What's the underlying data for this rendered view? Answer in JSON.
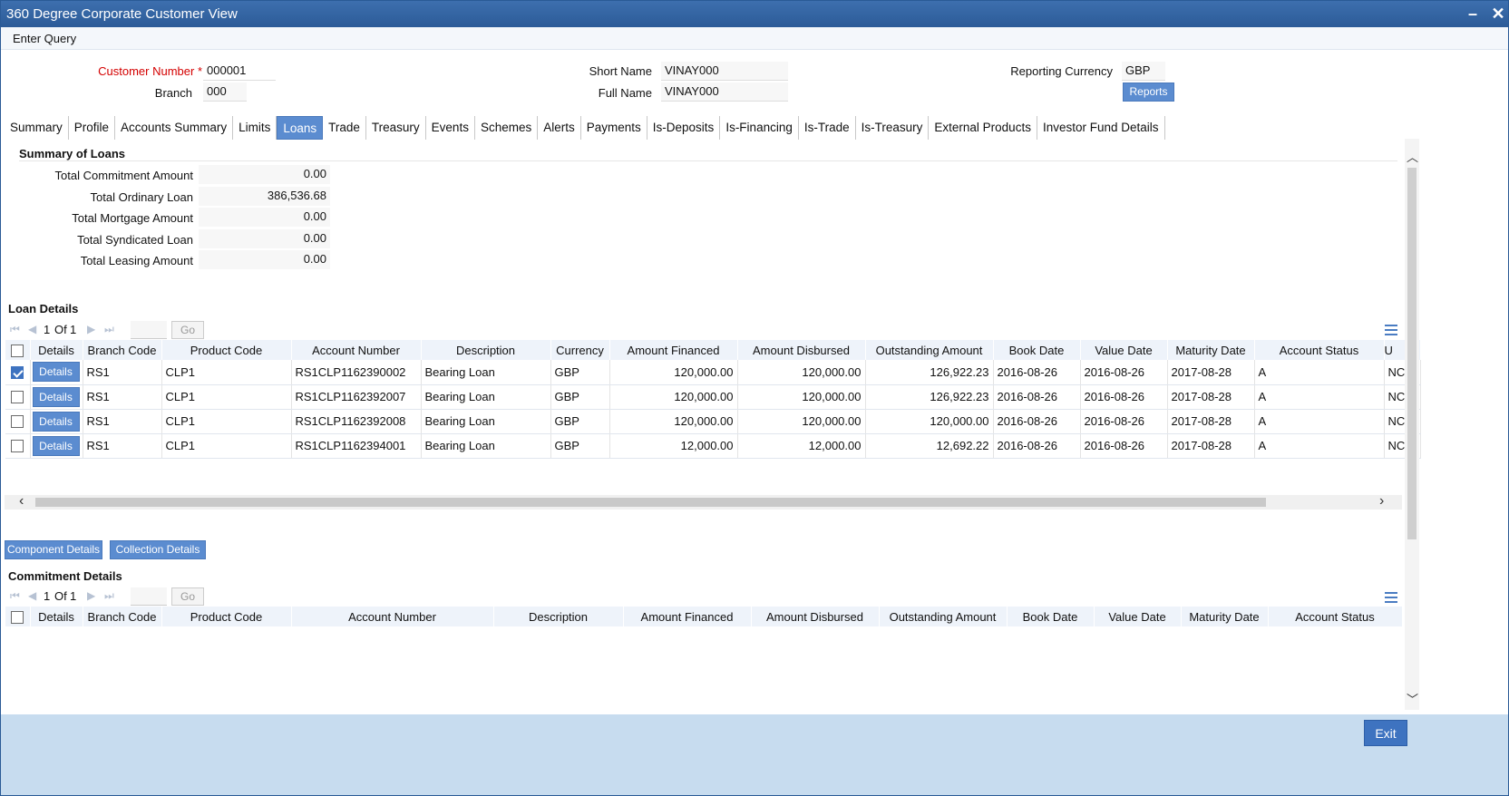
{
  "window": {
    "title": "360 Degree Corporate Customer View",
    "minimize": "–",
    "close": "✕"
  },
  "menu": {
    "enter_query": "Enter Query"
  },
  "header": {
    "customer_number_label": "Customer Number",
    "required_mark": "*",
    "customer_number": "000001",
    "branch_label": "Branch",
    "branch": "000",
    "short_name_label": "Short Name",
    "short_name": "VINAY000",
    "full_name_label": "Full Name",
    "full_name": "VINAY000",
    "reporting_currency_label": "Reporting Currency",
    "reporting_currency": "GBP",
    "reports_button": "Reports"
  },
  "tabs": [
    "Summary",
    "Profile",
    "Accounts Summary",
    "Limits",
    "Loans",
    "Trade",
    "Treasury",
    "Events",
    "Schemes",
    "Alerts",
    "Payments",
    "Is-Deposits",
    "Is-Financing",
    "Is-Trade",
    "Is-Treasury",
    "External Products",
    "Investor Fund Details"
  ],
  "active_tab": "Loans",
  "summary": {
    "title": "Summary of Loans",
    "rows": [
      {
        "label": "Total Commitment Amount",
        "value": "0.00"
      },
      {
        "label": "Total Ordinary Loan",
        "value": "386,536.68"
      },
      {
        "label": "Total Mortgage Amount",
        "value": "0.00"
      },
      {
        "label": "Total Syndicated Loan",
        "value": "0.00"
      },
      {
        "label": "Total Leasing Amount",
        "value": "0.00"
      }
    ]
  },
  "loan_details": {
    "title": "Loan Details",
    "pager": {
      "page": "1",
      "of": "Of",
      "total": "1",
      "go": "Go"
    },
    "columns": [
      "Details",
      "Branch Code",
      "Product Code",
      "Account Number",
      "Description",
      "Currency",
      "Amount Financed",
      "Amount Disbursed",
      "Outstanding Amount",
      "Book Date",
      "Value Date",
      "Maturity Date",
      "Account Status",
      "U"
    ],
    "details_button": "Details",
    "rows": [
      {
        "checked": true,
        "branch": "RS1",
        "product": "CLP1",
        "account": "RS1CLP1162390002",
        "description": "Bearing Loan",
        "currency": "GBP",
        "financed": "120,000.00",
        "disbursed": "120,000.00",
        "outstanding": "126,922.23",
        "book_date": "2016-08-26",
        "value_date": "2016-08-26",
        "maturity_date": "2017-08-28",
        "status": "A",
        "u": "NC"
      },
      {
        "checked": false,
        "branch": "RS1",
        "product": "CLP1",
        "account": "RS1CLP1162392007",
        "description": "Bearing Loan",
        "currency": "GBP",
        "financed": "120,000.00",
        "disbursed": "120,000.00",
        "outstanding": "126,922.23",
        "book_date": "2016-08-26",
        "value_date": "2016-08-26",
        "maturity_date": "2017-08-28",
        "status": "A",
        "u": "NC"
      },
      {
        "checked": false,
        "branch": "RS1",
        "product": "CLP1",
        "account": "RS1CLP1162392008",
        "description": "Bearing Loan",
        "currency": "GBP",
        "financed": "120,000.00",
        "disbursed": "120,000.00",
        "outstanding": "120,000.00",
        "book_date": "2016-08-26",
        "value_date": "2016-08-26",
        "maturity_date": "2017-08-28",
        "status": "A",
        "u": "NC"
      },
      {
        "checked": false,
        "branch": "RS1",
        "product": "CLP1",
        "account": "RS1CLP1162394001",
        "description": "Bearing Loan",
        "currency": "GBP",
        "financed": "12,000.00",
        "disbursed": "12,000.00",
        "outstanding": "12,692.22",
        "book_date": "2016-08-26",
        "value_date": "2016-08-26",
        "maturity_date": "2017-08-28",
        "status": "A",
        "u": "NC"
      }
    ]
  },
  "actions": {
    "component_details": "Component Details",
    "collection_details": "Collection Details"
  },
  "commitment_details": {
    "title": "Commitment Details",
    "pager": {
      "page": "1",
      "of": "Of",
      "total": "1",
      "go": "Go"
    },
    "columns": [
      "Details",
      "Branch Code",
      "Product Code",
      "Account Number",
      "Description",
      "Amount Financed",
      "Amount Disbursed",
      "Outstanding Amount",
      "Book Date",
      "Value Date",
      "Maturity Date",
      "Account Status"
    ]
  },
  "footer": {
    "exit": "Exit"
  },
  "icons": {
    "first": "first-page-icon",
    "prev": "prev-page-icon",
    "next": "next-page-icon",
    "last": "last-page-icon",
    "columns": "column-list-icon"
  },
  "colors": {
    "title_bar": "#2c5b98",
    "accent": "#5b8cd0",
    "footer": "#c7dcef",
    "required": "#d40000"
  }
}
